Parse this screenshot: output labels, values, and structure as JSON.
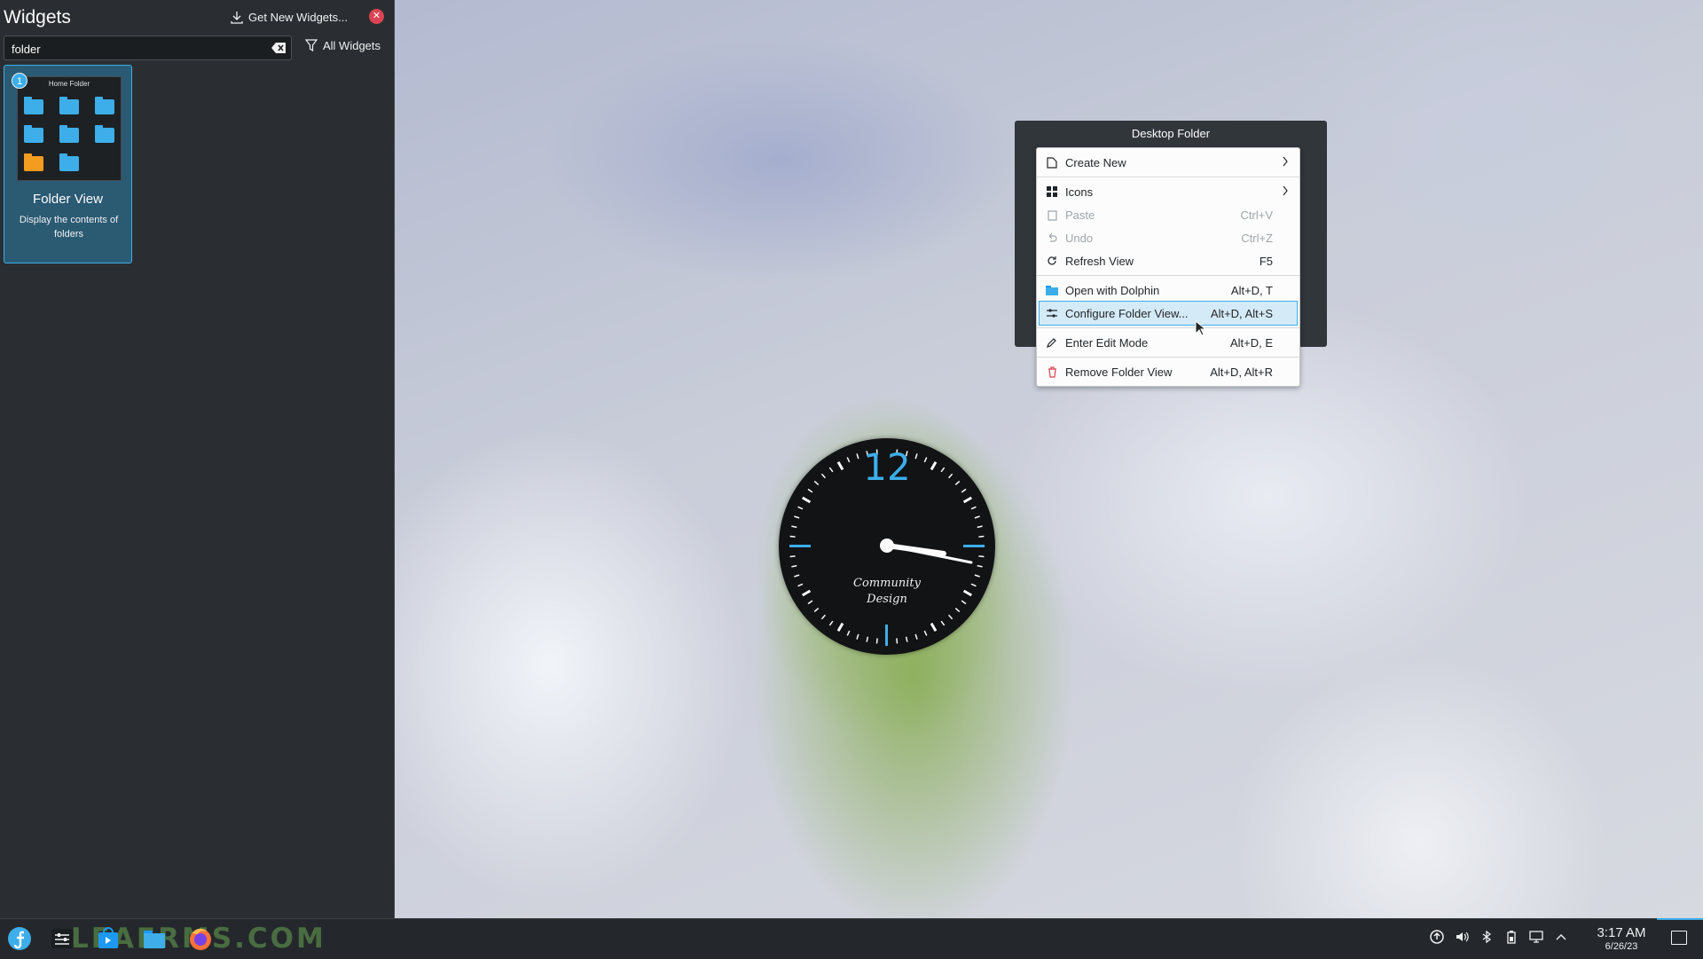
{
  "widgets_panel": {
    "title": "Widgets",
    "get_new_label": "Get New Widgets...",
    "search": {
      "value": "folder"
    },
    "filter_label": "All Widgets",
    "widget": {
      "name": "Folder View",
      "description": "Display the contents of folders",
      "preview_title": "Home Folder",
      "instance_count": "1"
    }
  },
  "desktop_folder": {
    "title": "Desktop Folder",
    "menu": [
      {
        "label": "Create New",
        "shortcut": "",
        "icon": "document-new-icon",
        "submenu": true
      },
      {
        "label": "Icons",
        "shortcut": "",
        "icon": "view-icons-icon",
        "submenu": true
      },
      {
        "label": "Paste",
        "shortcut": "Ctrl+V",
        "icon": "paste-icon",
        "disabled": true
      },
      {
        "label": "Undo",
        "shortcut": "Ctrl+Z",
        "icon": "undo-icon",
        "disabled": true
      },
      {
        "label": "Refresh View",
        "shortcut": "F5",
        "icon": "refresh-icon"
      },
      {
        "label": "Open with Dolphin",
        "shortcut": "Alt+D, T",
        "icon": "dolphin-folder-icon"
      },
      {
        "label": "Configure Folder View...",
        "shortcut": "Alt+D, Alt+S",
        "icon": "configure-icon",
        "highlighted": true
      },
      {
        "label": "Enter Edit Mode",
        "shortcut": "Alt+D, E",
        "icon": "edit-pencil-icon"
      },
      {
        "label": "Remove Folder View",
        "shortcut": "Alt+D, Alt+R",
        "icon": "trash-icon"
      }
    ]
  },
  "clock_widget": {
    "twelve": "12",
    "brand_line1": "Community",
    "brand_line2": "Design",
    "time_shown": "3:17"
  },
  "taskbar": {
    "watermark": "LEAFRMS.COM",
    "time": "3:17 AM",
    "date": "6/26/23",
    "tray_icons": [
      "updates-icon",
      "volume-icon",
      "bluetooth-icon",
      "battery-icon",
      "network-icon",
      "expand-tray-icon"
    ],
    "colors": {
      "accent": "#3daee9",
      "panel": "#24282c"
    }
  }
}
